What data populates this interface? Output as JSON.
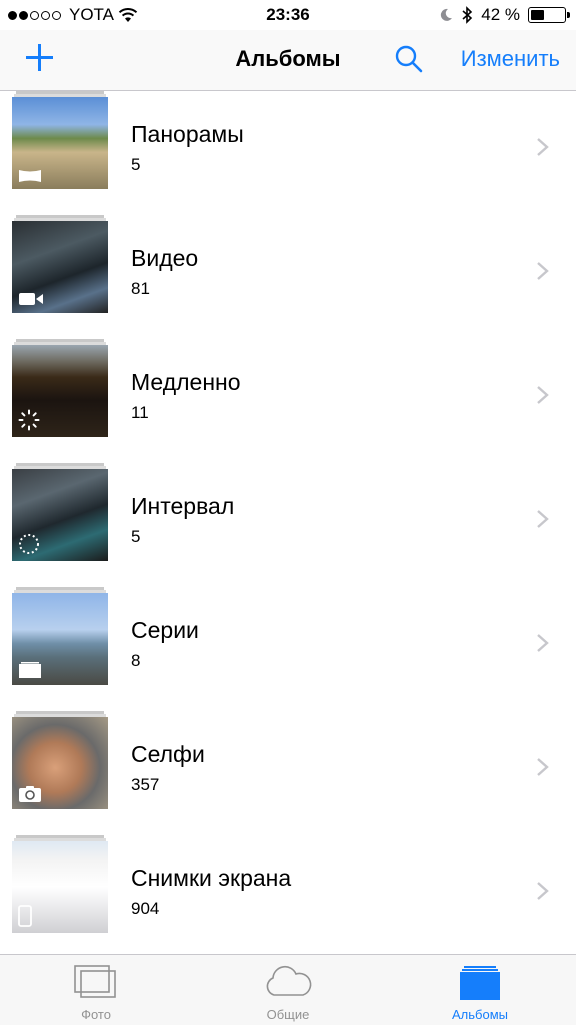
{
  "status_bar": {
    "carrier": "YOTA",
    "time": "23:36",
    "battery": "42 %",
    "battery_level": 0.42
  },
  "nav": {
    "title": "Альбомы",
    "edit_label": "Изменить"
  },
  "albums": [
    {
      "title": "Панорамы",
      "count": "5",
      "icon": "panorama-icon"
    },
    {
      "title": "Видео",
      "count": "81",
      "icon": "video-camera-icon"
    },
    {
      "title": "Медленно",
      "count": "11",
      "icon": "slow-motion-icon"
    },
    {
      "title": "Интервал",
      "count": "5",
      "icon": "time-lapse-icon"
    },
    {
      "title": "Серии",
      "count": "8",
      "icon": "burst-icon"
    },
    {
      "title": "Селфи",
      "count": "357",
      "icon": "front-camera-icon"
    },
    {
      "title": "Снимки экрана",
      "count": "904",
      "icon": "screenshot-icon"
    }
  ],
  "tabs": [
    {
      "label": "Фото",
      "icon": "photos-icon",
      "active": false
    },
    {
      "label": "Общие",
      "icon": "cloud-icon",
      "active": false
    },
    {
      "label": "Альбомы",
      "icon": "albums-icon",
      "active": true
    }
  ],
  "colors": {
    "accent": "#157efb",
    "inactive": "#929292"
  }
}
